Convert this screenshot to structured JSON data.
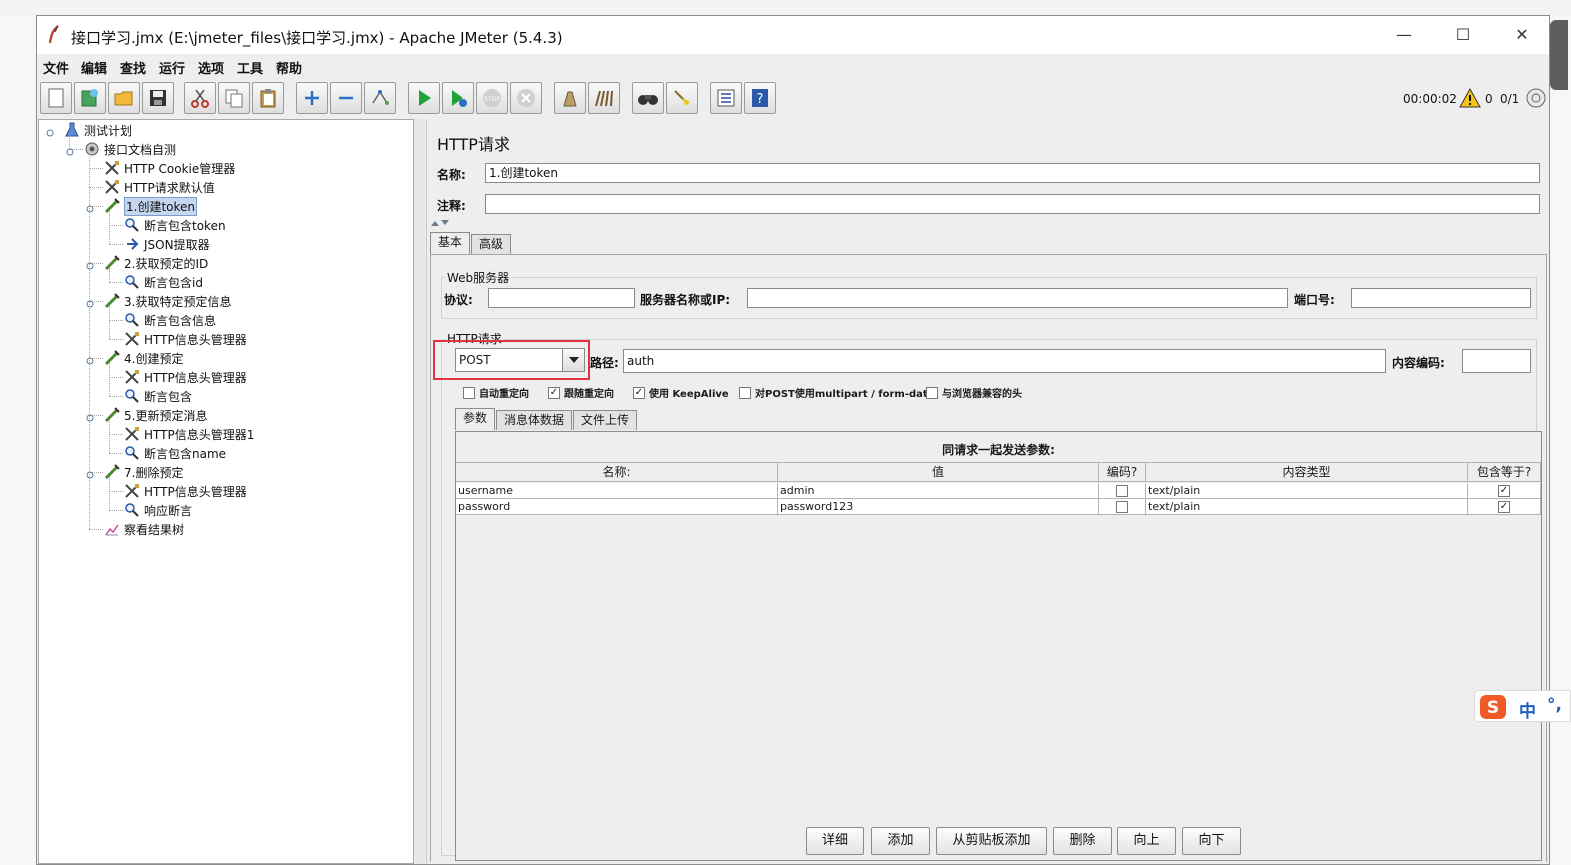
{
  "window": {
    "title": "接口学习.jmx (E:\\jmeter_files\\接口学习.jmx) - Apache JMeter (5.4.3)",
    "minimize": "—",
    "maximize": "☐",
    "close": "✕"
  },
  "menu": [
    "文件",
    "编辑",
    "查找",
    "运行",
    "选项",
    "工具",
    "帮助"
  ],
  "toolbar": {
    "icons": [
      "new-icon",
      "templates-icon",
      "open-icon",
      "save-icon",
      "cut-icon",
      "copy-icon",
      "paste-icon",
      "expand-icon",
      "collapse-icon",
      "toggle-icon",
      "start-icon",
      "start-no-pause-icon",
      "stop-icon",
      "shutdown-icon",
      "clear-icon",
      "clear-all-icon",
      "search-icon",
      "reset-search-icon",
      "function-helper-icon",
      "help-icon"
    ],
    "timer": "00:00:02",
    "warning_count": "0",
    "threads": "0/1"
  },
  "tree": {
    "nodes": [
      {
        "label": "测试计划",
        "icon": "test-plan-icon",
        "level": 0
      },
      {
        "label": "接口文档自测",
        "icon": "thread-group-icon",
        "level": 1
      },
      {
        "label": "HTTP Cookie管理器",
        "icon": "config-element-icon",
        "level": 2
      },
      {
        "label": "HTTP请求默认值",
        "icon": "config-element-icon",
        "level": 2
      },
      {
        "label": "1.创建token",
        "icon": "sampler-icon",
        "level": 2,
        "selected": true
      },
      {
        "label": "断言包含token",
        "icon": "assertion-icon",
        "level": 3
      },
      {
        "label": "JSON提取器",
        "icon": "extractor-icon",
        "level": 3
      },
      {
        "label": "2.获取预定的ID",
        "icon": "sampler-icon",
        "level": 2
      },
      {
        "label": "断言包含id",
        "icon": "assertion-icon",
        "level": 3
      },
      {
        "label": "3.获取特定预定信息",
        "icon": "sampler-icon",
        "level": 2
      },
      {
        "label": "断言包含信息",
        "icon": "assertion-icon",
        "level": 3
      },
      {
        "label": "HTTP信息头管理器",
        "icon": "config-element-icon",
        "level": 3
      },
      {
        "label": "4.创建预定",
        "icon": "sampler-icon",
        "level": 2
      },
      {
        "label": "HTTP信息头管理器",
        "icon": "config-element-icon",
        "level": 3
      },
      {
        "label": "断言包含",
        "icon": "assertion-icon",
        "level": 3
      },
      {
        "label": "5.更新预定消息",
        "icon": "sampler-icon",
        "level": 2
      },
      {
        "label": "HTTP信息头管理器1",
        "icon": "config-element-icon",
        "level": 3
      },
      {
        "label": "断言包含name",
        "icon": "assertion-icon",
        "level": 3
      },
      {
        "label": "7.删除预定",
        "icon": "sampler-icon",
        "level": 2
      },
      {
        "label": "HTTP信息头管理器",
        "icon": "config-element-icon",
        "level": 3
      },
      {
        "label": "响应断言",
        "icon": "assertion-icon",
        "level": 3
      },
      {
        "label": "察看结果树",
        "icon": "listener-icon",
        "level": 2
      }
    ]
  },
  "panel": {
    "title": "HTTP请求",
    "name_label": "名称:",
    "name_value": "1.创建token",
    "comment_label": "注释:",
    "comment_value": "",
    "tabs": [
      "基本",
      "高级"
    ],
    "web_server": {
      "title": "Web服务器",
      "protocol_label": "协议:",
      "protocol_value": "",
      "server_label": "服务器名称或IP:",
      "server_value": "",
      "port_label": "端口号:",
      "port_value": ""
    },
    "http_request": {
      "title": "HTTP请求",
      "method": "POST",
      "path_label": "路径:",
      "path_value": "auth",
      "encoding_label": "内容编码:",
      "encoding_value": ""
    },
    "checkboxes": [
      {
        "label": "自动重定向",
        "checked": false
      },
      {
        "label": "跟随重定向",
        "checked": true
      },
      {
        "label": "使用 KeepAlive",
        "checked": true
      },
      {
        "label": "对POST使用multipart / form-data",
        "checked": false
      },
      {
        "label": "与浏览器兼容的头",
        "checked": false
      }
    ],
    "sub_tabs": [
      "参数",
      "消息体数据",
      "文件上传"
    ],
    "params_caption": "同请求一起发送参数:",
    "columns": [
      "名称:",
      "值",
      "编码?",
      "内容类型",
      "包含等于?"
    ],
    "rows": [
      {
        "name": "username",
        "value": "admin",
        "encode": false,
        "content_type": "text/plain",
        "include_equals": true
      },
      {
        "name": "password",
        "value": "password123",
        "encode": false,
        "content_type": "text/plain",
        "include_equals": true
      }
    ],
    "buttons": [
      "详细",
      "添加",
      "从剪贴板添加",
      "删除",
      "向上",
      "向下"
    ]
  },
  "ime": {
    "char": "中",
    "punct": "°,"
  },
  "colors": {
    "highlight_box": "#e0333c",
    "selection": "#c5d6ef",
    "start_green": "#1ea33a"
  }
}
